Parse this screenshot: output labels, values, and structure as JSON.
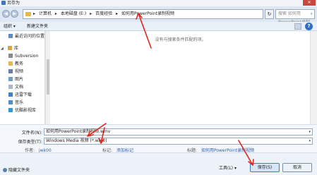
{
  "window": {
    "title": "另存为",
    "close_glyph": "✕"
  },
  "address": {
    "crumbs": [
      "▸",
      "计算机",
      "▸",
      "本地磁盘 (E:)",
      "▸",
      "百度经验",
      "▸",
      "如何用PowerPoint录制视频"
    ],
    "refresh_glyph": "↻",
    "search_placeholder": "搜索 如何用PowerPoint录制视频",
    "search_glyph": "⌕"
  },
  "nav_buttons": {
    "back": "◀",
    "forward": "▶"
  },
  "toolbar": {
    "organize": "组织 ▾",
    "new_folder": "新建文件夹",
    "help": "?"
  },
  "nav_pane": {
    "items": [
      {
        "label": "最近访问的位置",
        "icon": "recent-places-icon",
        "color": "#5b8cc9",
        "sub": true
      },
      {
        "label": "库",
        "icon": "library-icon",
        "color": "#d9a441",
        "sub": false,
        "expander": "◢"
      },
      {
        "label": "Subversion",
        "icon": "subversion-icon",
        "color": "#8a8a8a",
        "sub": true
      },
      {
        "label": "教务",
        "icon": "folder-icon",
        "color": "#e4b84f",
        "sub": true
      },
      {
        "label": "视频",
        "icon": "video-icon",
        "color": "#6a7fa8",
        "sub": true
      },
      {
        "label": "图片",
        "icon": "pictures-icon",
        "color": "#6aa0c9",
        "sub": true
      },
      {
        "label": "文档",
        "icon": "documents-icon",
        "color": "#a9b7c9",
        "sub": true
      },
      {
        "label": "迅雷下载",
        "icon": "download-icon",
        "color": "#3f7fd1",
        "sub": true
      },
      {
        "label": "音乐",
        "icon": "music-icon",
        "color": "#4a8fd1",
        "sub": true
      },
      {
        "label": "优酷影视库",
        "icon": "youku-icon",
        "color": "#2f9ad6",
        "sub": true
      }
    ]
  },
  "content": {
    "empty_message": "没有与搜索条件匹配的项。"
  },
  "form": {
    "filename_label": "文件名(N):",
    "filename_value": "如何用PowerPoint录制视频.wmv",
    "filetype_label": "保存类型(T):",
    "filetype_value": "Windows Media 视频 (*.wmv)",
    "dropdown_glyph": "▾",
    "author_label": "作者:",
    "author_value": "jwk00",
    "tags_label": "标记:",
    "tags_value": "添加标记",
    "title_label": "标题:",
    "title_value": "如何用PowerPoint录制视频"
  },
  "footer": {
    "hide_folders": "隐藏文件夹",
    "tools": "工具(L)",
    "tools_dropdown": "▾",
    "save": "保存(S)",
    "cancel": "取消"
  },
  "colors": {
    "annotation_red": "#e0261d"
  }
}
